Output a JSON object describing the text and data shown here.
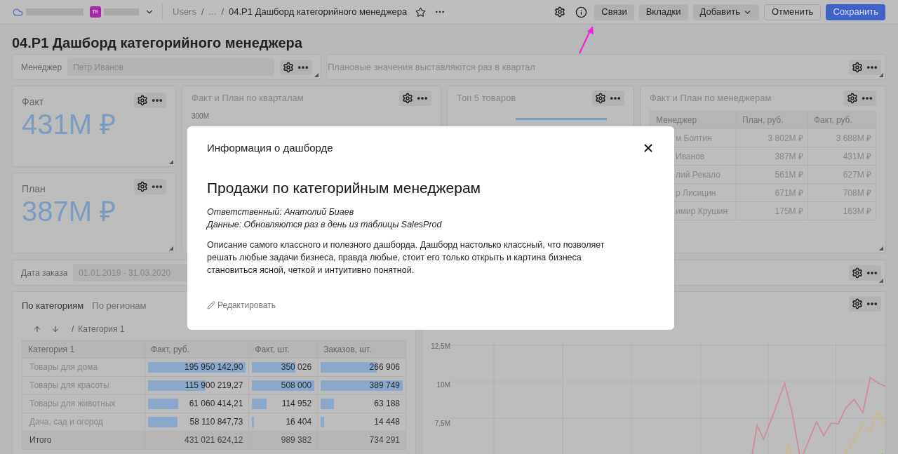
{
  "topbar": {
    "avatar": "TE",
    "separator": "/",
    "breadcrumbs": [
      "Users",
      "...",
      "04.P1 Дашборд категорийного менеджера"
    ],
    "buttons": [
      {
        "label": "Связи",
        "kind": "secondary"
      },
      {
        "label": "Вкладки",
        "kind": "secondary"
      },
      {
        "label": "Добавить",
        "kind": "dropdown"
      },
      {
        "label": "Отменить",
        "kind": "outline"
      },
      {
        "label": "Сохранить",
        "kind": "primary"
      }
    ]
  },
  "page_title": "04.P1 Дашборд категорийного менеджера",
  "manager_filter": {
    "label": "Менеджер",
    "value": "Петр Иванов"
  },
  "note_card": {
    "text": "Плановые значения выставляются раз в квартал"
  },
  "kpis": [
    {
      "title": "Факт",
      "value": "431M ₽"
    },
    {
      "title": "План",
      "value": "387M ₽"
    }
  ],
  "quarter_chart": {
    "title": "Факт и План по кварталам",
    "y_axis_label": "300M"
  },
  "top_products": {
    "title": "Топ 5 товаров"
  },
  "manager_table": {
    "title": "Факт и План по менеджерам",
    "columns": [
      "Менеджер",
      "План, руб.",
      "Факт, руб."
    ],
    "rows": [
      [
        "м Болтин",
        "3 802M ₽",
        "3 688M ₽"
      ],
      [
        "Иванов",
        "387M ₽",
        "431M ₽"
      ],
      [
        "лий Рекало",
        "561M ₽",
        "627M ₽"
      ],
      [
        "р Лисицин",
        "671M ₽",
        "708M ₽"
      ],
      [
        "имир Крушин",
        "175M ₽",
        "163M ₽"
      ]
    ]
  },
  "date_filter": {
    "label": "Дата заказа",
    "value": "01.01.2019 - 31.03.2020"
  },
  "category_widget": {
    "tabs": [
      {
        "label": "По категориям",
        "selected": true
      },
      {
        "label": "По регионам",
        "selected": false
      }
    ],
    "breadcrumb_separator": "/",
    "breadcrumb": "Категория 1",
    "columns": [
      "Категория 1",
      "Факт, руб.",
      "Факт, шт.",
      "Заказов, шт."
    ],
    "rows": [
      {
        "cells": [
          {
            "text": "Товары для дома"
          },
          {
            "text": "195 950 142,90",
            "level": 1
          },
          {
            "text": "350 026",
            "level": 0.69
          },
          {
            "text": "266 906",
            "level": 0.68
          }
        ]
      },
      {
        "cells": [
          {
            "text": "Товары для красоты"
          },
          {
            "text": "115 900 219,27",
            "level": 0.59
          },
          {
            "text": "508 000",
            "level": 1
          },
          {
            "text": "389 749",
            "level": 1
          }
        ]
      },
      {
        "cells": [
          {
            "text": "Товары для животных"
          },
          {
            "text": "61 060 414,21",
            "level": 0.31
          },
          {
            "text": "114 952",
            "level": 0.23
          },
          {
            "text": "63 188",
            "level": 0.16
          }
        ]
      },
      {
        "cells": [
          {
            "text": "Дача, сад и огород"
          },
          {
            "text": "58 110 847,73",
            "level": 0.3
          },
          {
            "text": "16 404",
            "level": 0.03
          },
          {
            "text": "14 448",
            "level": 0.04
          }
        ]
      }
    ],
    "total": [
      "Итого",
      "431 021 624,12",
      "989 382",
      "734 291"
    ]
  },
  "trend_chart": {
    "y_axis_labels": [
      "12,5M",
      "10M",
      "7,5M"
    ]
  },
  "modal": {
    "title": "Информация о дашборде",
    "heading": "Продажи по категорийным менеджерам",
    "meta": [
      "Ответственный: Анатолий Биаев",
      "Данные: Обновляются раз в день из таблицы SalesProd"
    ],
    "description": "Описание самого классного и полезного дашборда. Дашборд настолько классный, что позволяет решать любые задачи бизнеса, правда любые, стоит его только открыть и картина бизнеса становиться ясной, четкой и интуитивно понятной.",
    "edit_link": "Редактировать"
  }
}
